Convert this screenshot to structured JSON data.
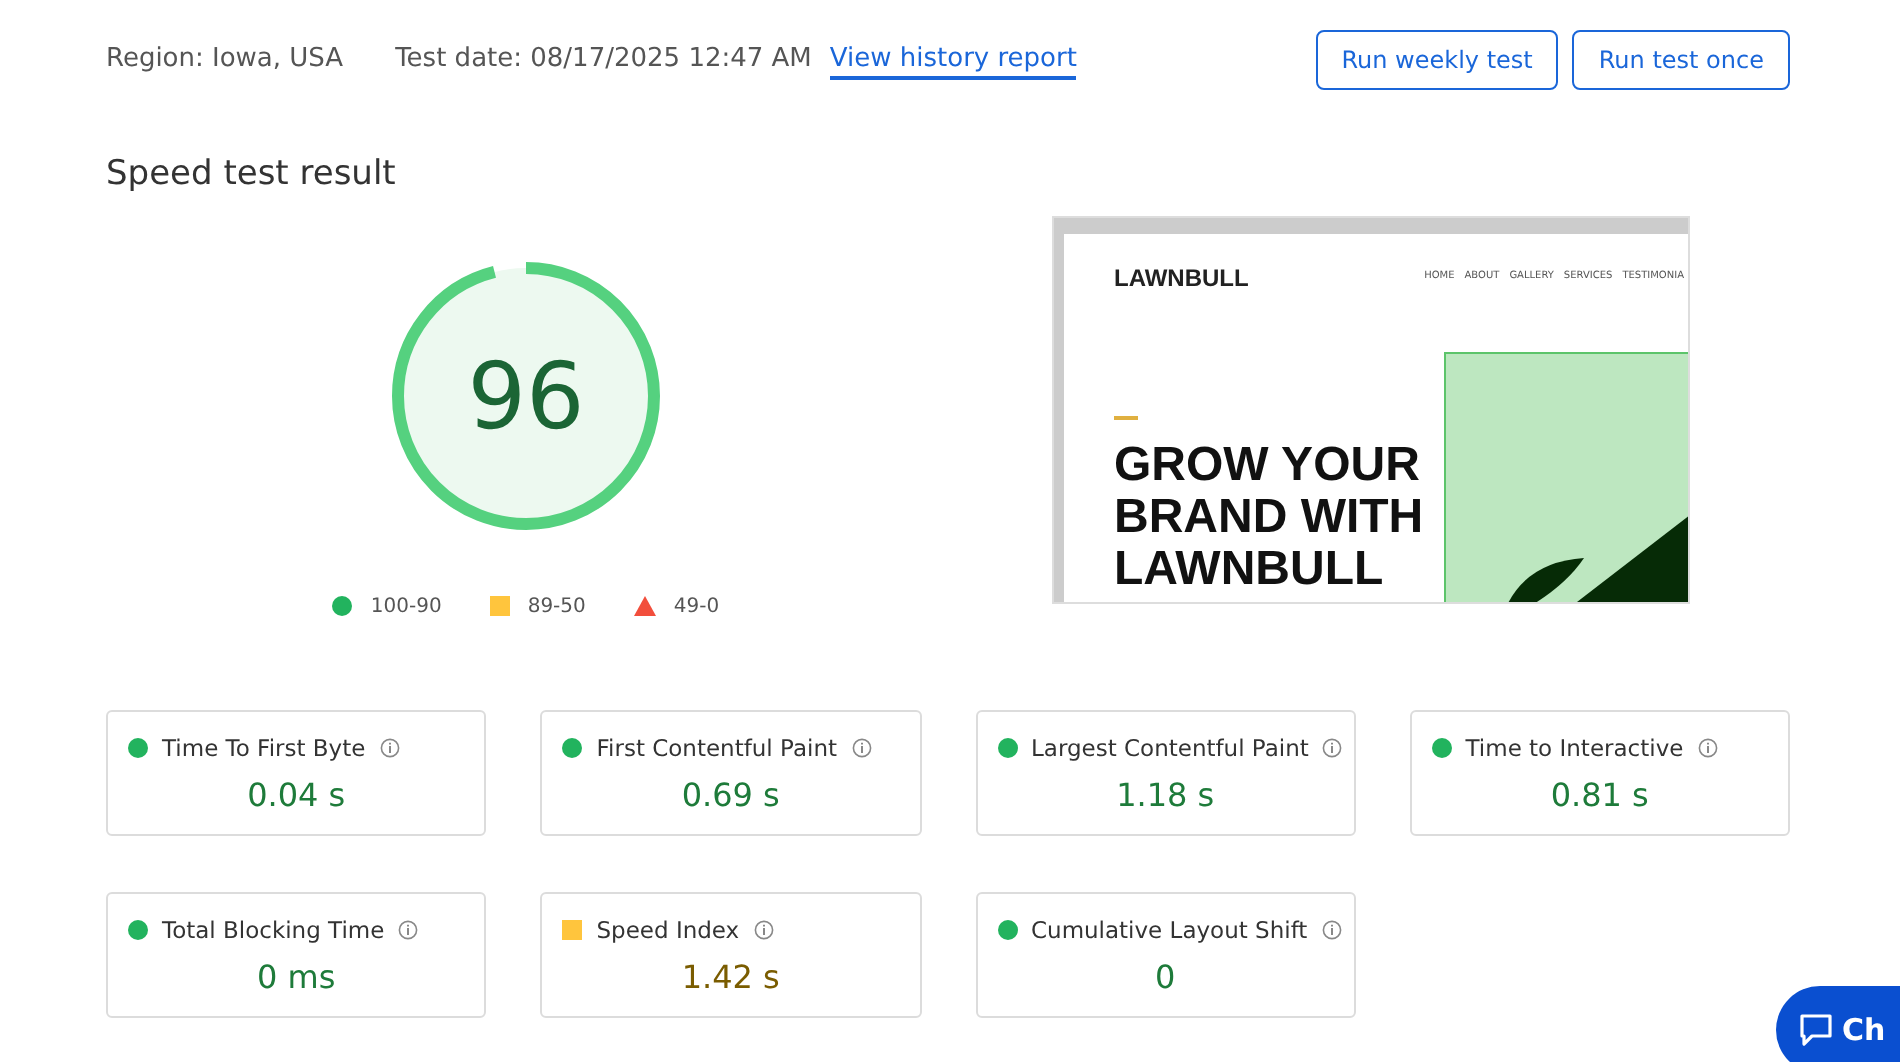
{
  "header": {
    "region": "Region: Iowa, USA",
    "test_date": "Test date: 08/17/2025 12:47 AM",
    "history_link": "View history report"
  },
  "buttons": [
    "Run weekly test",
    "Run test once"
  ],
  "title": "Speed test result",
  "score": {
    "value": "96",
    "level": 0.96
  },
  "legend": [
    {
      "kind": "good",
      "label": "100-90"
    },
    {
      "kind": "average",
      "label": "89-50"
    },
    {
      "kind": "poor",
      "label": "49-0"
    }
  ],
  "preview": {
    "logo": "LAWNBULL",
    "nav": [
      "HOME",
      "ABOUT",
      "GALLERY",
      "SERVICES",
      "TESTIMONIA"
    ],
    "headline": [
      "GROW YOUR",
      "BRAND WITH",
      "LAWNBULL"
    ]
  },
  "metrics": [
    {
      "label": "Time To First Byte",
      "value": "0.04 s",
      "kind": "good"
    },
    {
      "label": "First Contentful Paint",
      "value": "0.69 s",
      "kind": "good"
    },
    {
      "label": "Largest Contentful Paint",
      "value": "1.18 s",
      "kind": "good"
    },
    {
      "label": "Time to Interactive",
      "value": "0.81 s",
      "kind": "good"
    },
    {
      "label": "Total Blocking Time",
      "value": "0 ms",
      "kind": "good"
    },
    {
      "label": "Speed Index",
      "value": "1.42 s",
      "kind": "average"
    },
    {
      "label": "Cumulative Layout Shift",
      "value": "0",
      "kind": "good"
    }
  ],
  "chat_button": {
    "label": "Ch"
  }
}
